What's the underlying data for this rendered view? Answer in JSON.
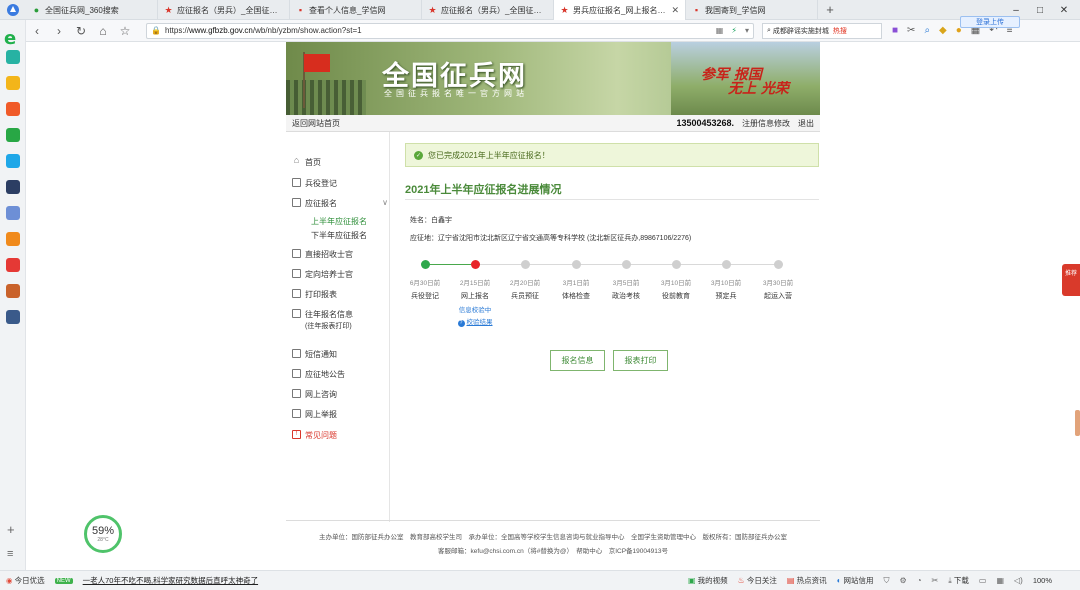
{
  "browser": {
    "tabs": [
      {
        "label": "全国征兵网_360搜索",
        "icon": "search-icon",
        "color": "#2a9d3a"
      },
      {
        "label": "应征报名（男兵）_全国征兵网",
        "icon": "star-icon",
        "color": "#d9362b"
      },
      {
        "label": "查看个人信息_学信网",
        "icon": "document-icon",
        "color": "#d9362b"
      },
      {
        "label": "应征报名（男兵）_全国征兵网",
        "icon": "star-icon",
        "color": "#d9362b"
      },
      {
        "label": "男兵应征报名_网上报名_全国征",
        "icon": "star-icon",
        "color": "#d9362b",
        "active": true
      },
      {
        "label": "我国寄到_学信网",
        "icon": "document-icon",
        "color": "#d9362b"
      }
    ],
    "new_tab": "+",
    "window_controls": {
      "minimize": "–",
      "maximize": "□",
      "close": "✕"
    },
    "address": {
      "url_prefix": "https://",
      "url_host": "www.gfbzb.gov.cn",
      "url_path": "/wb/nb/yzbm/show.action?st=1"
    },
    "search_hint": "成都辟谣实施封城",
    "search_hot": "热搜",
    "cloud_button": "登录上传"
  },
  "site": {
    "title": "全国征兵网",
    "subtitle": "全国征兵报名唯一官方网站",
    "slogan_1": "参军 报国",
    "slogan_2": "无上 光荣",
    "back_home": "返回网站首页",
    "phone": "13500453268.",
    "edit_info": "注册信息修改",
    "logout": "退出"
  },
  "nav": {
    "items": [
      {
        "label": "首页",
        "icon": "home-icon"
      },
      {
        "label": "兵役登记",
        "icon": "register-icon"
      },
      {
        "label": "应征报名",
        "icon": "apply-icon"
      },
      {
        "label": "直接招收士官",
        "icon": "recruit-icon"
      },
      {
        "label": "定向培养士官",
        "icon": "training-icon"
      },
      {
        "label": "打印报表",
        "icon": "printer-icon"
      },
      {
        "label": "往年报名信息",
        "sub": "(往年报表打印)",
        "icon": "history-icon"
      },
      {
        "label": "短信通知",
        "icon": "message-icon"
      },
      {
        "label": "应征地公告",
        "icon": "notice-icon"
      },
      {
        "label": "网上咨询",
        "icon": "chat-icon"
      },
      {
        "label": "网上举报",
        "icon": "mail-icon"
      },
      {
        "label": "常见问题",
        "icon": "help-icon"
      }
    ],
    "subitems": [
      {
        "label": "上半年应征报名"
      },
      {
        "label": "下半年应征报名"
      }
    ]
  },
  "content": {
    "alert": "您已完成2021年上半年应征报名！",
    "title": "2021年上半年应征报名进展情况",
    "name_label": "姓名：",
    "name_value": "白鑫宇",
    "place_label": "应征地：",
    "place_value": "辽宁省沈阳市沈北新区辽宁省交通高等专科学校 (沈北新区征兵办,89867106/2276)",
    "steps": [
      {
        "date": "6月30日前",
        "name": "兵役登记",
        "state": "done"
      },
      {
        "date": "2月15日前",
        "name": "网上报名",
        "state": "current",
        "status": "信息校验中",
        "link": "校验结果"
      },
      {
        "date": "2月20日前",
        "name": "兵员预征",
        "state": "todo"
      },
      {
        "date": "3月1日前",
        "name": "体格检查",
        "state": "todo"
      },
      {
        "date": "3月5日前",
        "name": "政治考核",
        "state": "todo"
      },
      {
        "date": "3月10日前",
        "name": "役前教育",
        "state": "todo"
      },
      {
        "date": "3月10日前",
        "name": "预定兵",
        "state": "todo"
      },
      {
        "date": "3月30日前",
        "name": "起运入营",
        "state": "todo"
      }
    ],
    "btn_info": "报名信息",
    "btn_print": "报表打印"
  },
  "footer": {
    "line1": "主办单位：国防部征兵办公室　教育部高校学生司　承办单位：全国高等学校学生信息咨询与就业指导中心　全国学生资助管理中心　版权所有：国防部征兵办公室",
    "line2": "客服邮箱：kefu@chsi.com.cn（将#替换为@）　帮助中心　京ICP备19004913号"
  },
  "weather": {
    "value": "59%",
    "temp": "28°C"
  },
  "side_badge": "推荐",
  "statusbar": {
    "today": "今日优选",
    "news_badge": "NEW",
    "news": "一老人70年不吃不喝,科学家研究数据后直呼太神奇了",
    "my_video": "我的视频",
    "hot": "今日关注",
    "hotspot": "热点资讯",
    "credit": "网站信用",
    "download": "下载",
    "zoom": "100%"
  }
}
